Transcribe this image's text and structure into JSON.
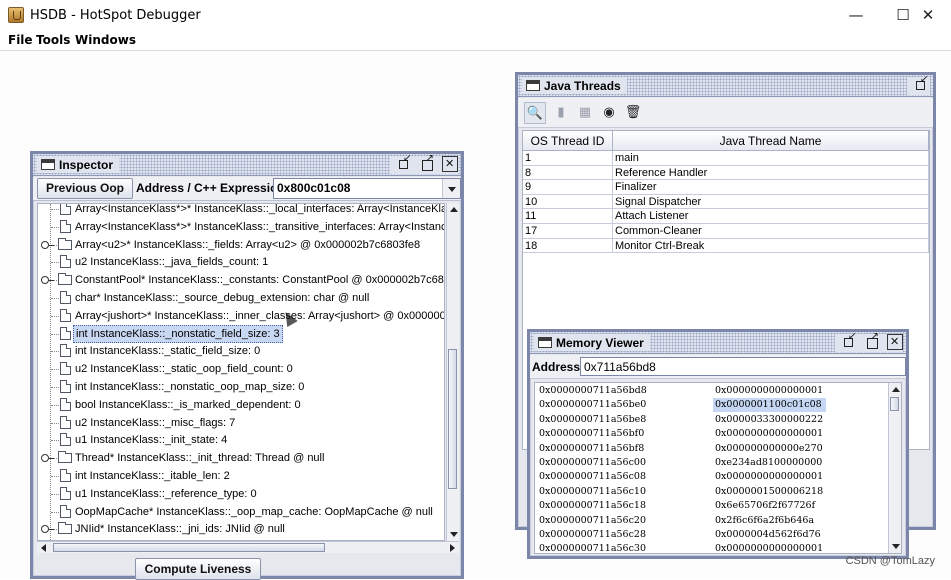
{
  "app": {
    "title": "HSDB - HotSpot Debugger"
  },
  "window_controls": {
    "minimize": "—",
    "maximize": "☐",
    "close": "✕"
  },
  "menu": {
    "file": "File",
    "tools": "Tools",
    "windows": "Windows"
  },
  "inspector": {
    "title": "Inspector",
    "previous_oop_label": "Previous Oop",
    "address_label": "Address / C++ Expression:",
    "address_value": "0x800c01c08",
    "compute_liveness_label": "Compute Liveness",
    "tree_items": [
      "Array<InstanceKlass*>* InstanceKlass::_local_interfaces: Array<InstanceKla",
      "Array<InstanceKlass*>* InstanceKlass::_transitive_interfaces: Array<Instanc",
      "Array<u2>* InstanceKlass::_fields: Array<u2> @ 0x000002b7c6803fe8",
      "u2 InstanceKlass::_java_fields_count: 1",
      "ConstantPool* InstanceKlass::_constants: ConstantPool @ 0x000002b7c68",
      "char* InstanceKlass::_source_debug_extension: char @ null",
      "Array<jushort>* InstanceKlass::_inner_classes: Array<jushort> @ 0x000000",
      "int InstanceKlass::_nonstatic_field_size: 3",
      "int InstanceKlass::_static_field_size: 0",
      "u2 InstanceKlass::_static_oop_field_count: 0",
      "int InstanceKlass::_nonstatic_oop_map_size: 0",
      "bool InstanceKlass::_is_marked_dependent: 0",
      "u2 InstanceKlass::_misc_flags: 7",
      "u1 InstanceKlass::_init_state: 4",
      "Thread* InstanceKlass::_init_thread: Thread @ null",
      "int InstanceKlass::_itable_len: 2",
      "u1 InstanceKlass::_reference_type: 0",
      "OopMapCache* InstanceKlass::_oop_map_cache: OopMapCache @ null",
      "JNIid* InstanceKlass::_jni_ids: JNIid @ null"
    ]
  },
  "threads": {
    "title": "Java Threads",
    "toolbar_icons": [
      "search-icon",
      "stack-icon",
      "memory-icon",
      "info-icon",
      "trash-icon"
    ],
    "columns": [
      "OS Thread ID",
      "Java Thread Name"
    ],
    "rows": [
      {
        "id": "1",
        "name": "main"
      },
      {
        "id": "8",
        "name": "Reference Handler"
      },
      {
        "id": "9",
        "name": "Finalizer"
      },
      {
        "id": "10",
        "name": "Signal Dispatcher"
      },
      {
        "id": "11",
        "name": "Attach Listener"
      },
      {
        "id": "17",
        "name": "Common-Cleaner"
      },
      {
        "id": "18",
        "name": "Monitor Ctrl-Break"
      }
    ]
  },
  "memory": {
    "title": "Memory Viewer",
    "address_label": "Address:",
    "address_value": "0x711a56bd8",
    "rows": [
      {
        "addr": "0x0000000711a56bd8",
        "val": "0x0000000000000001"
      },
      {
        "addr": "0x0000000711a56be0",
        "val": "0x0000001100c01c08"
      },
      {
        "addr": "0x0000000711a56be8",
        "val": "0x0000033300000222"
      },
      {
        "addr": "0x0000000711a56bf0",
        "val": "0x0000000000000001"
      },
      {
        "addr": "0x0000000711a56bf8",
        "val": "0x000000000000e270"
      },
      {
        "addr": "0x0000000711a56c00",
        "val": "0xe234ad8100000000"
      },
      {
        "addr": "0x0000000711a56c08",
        "val": "0x0000000000000001"
      },
      {
        "addr": "0x0000000711a56c10",
        "val": "0x0000001500006218"
      },
      {
        "addr": "0x0000000711a56c18",
        "val": "0x6e65706f2f67726f"
      },
      {
        "addr": "0x0000000711a56c20",
        "val": "0x2f6c6f6a2f6b646a"
      },
      {
        "addr": "0x0000000711a56c28",
        "val": "0x0000004d562f6d76"
      },
      {
        "addr": "0x0000000711a56c30",
        "val": "0x0000000000000001"
      }
    ]
  },
  "watermark": "CSDN @TomLazy"
}
